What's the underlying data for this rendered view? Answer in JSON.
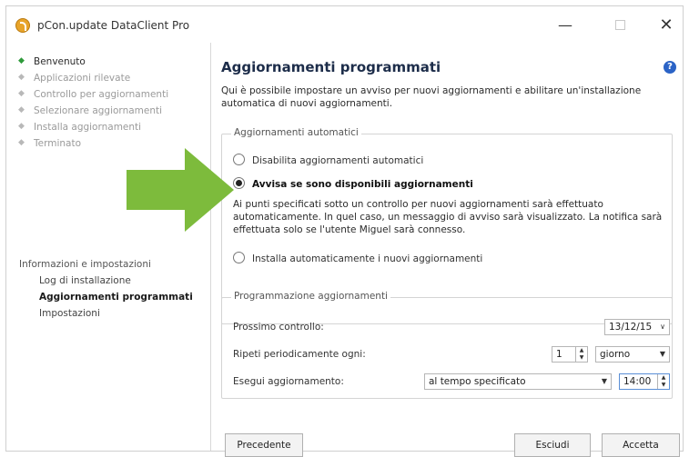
{
  "window": {
    "title": "pCon.update DataClient Pro"
  },
  "sidebar": {
    "steps": [
      {
        "label": "Benvenuto",
        "active": true
      },
      {
        "label": "Applicazioni rilevate",
        "active": false
      },
      {
        "label": "Controllo per aggiornamenti",
        "active": false
      },
      {
        "label": "Selezionare aggiornamenti",
        "active": false
      },
      {
        "label": "Installa aggiornamenti",
        "active": false
      },
      {
        "label": "Terminato",
        "active": false
      }
    ],
    "info_title": "Informazioni e impostazioni",
    "info_links": [
      "Log di installazione",
      "Aggiornamenti programmati",
      "Impostazioni"
    ]
  },
  "main": {
    "heading": "Aggiornamenti programmati",
    "help_icon": "?",
    "intro": "Qui è possibile impostare un avviso per nuovi aggiornamenti e abilitare un'installazione automatica di nuovi aggiornamenti.",
    "auto_group": {
      "label": "Aggiornamenti automatici",
      "options": [
        "Disabilita aggiornamenti automatici",
        "Avvisa se sono disponibili aggiornamenti",
        "Installa automaticamente i nuovi aggiornamenti"
      ],
      "selected_index": 1,
      "description": "Ai punti specificati sotto un controllo per nuovi aggiornamenti sarà effettuato automaticamente. In quel caso, un messaggio di avviso sarà visualizzato. La notifica sarà effettuata solo se l'utente Miguel sarà connesso."
    },
    "schedule_group": {
      "label": "Programmazione aggiornamenti",
      "next_check_label": "Prossimo controllo:",
      "next_check_value": "13/12/15",
      "repeat_label": "Ripeti periodicamente ogni:",
      "repeat_value": "1",
      "repeat_unit": "giorno",
      "execute_label": "Esegui aggiornamento:",
      "execute_mode": "al tempo specificato",
      "execute_time": "14:00"
    }
  },
  "buttons": {
    "previous": "Precedente",
    "exit": "Esciudi",
    "accept": "Accetta"
  },
  "colors": {
    "arrow": "#7dbb3c",
    "active_step": "#2e9a3a",
    "help": "#2b63c6"
  }
}
